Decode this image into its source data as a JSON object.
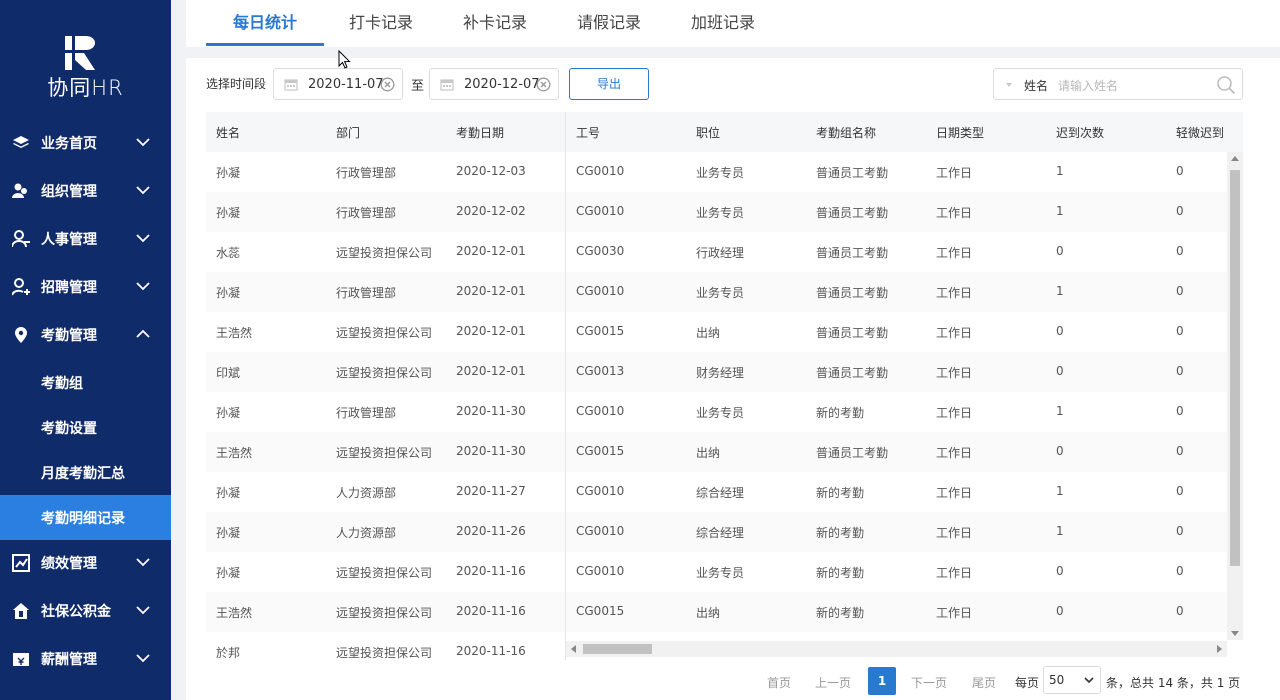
{
  "app": {
    "name": "协同HR"
  },
  "sidebar": {
    "menus": [
      {
        "label": "业务首页",
        "icon": "layers-icon",
        "expanded": false
      },
      {
        "label": "组织管理",
        "icon": "org-icon",
        "expanded": false
      },
      {
        "label": "人事管理",
        "icon": "person-icon",
        "expanded": false
      },
      {
        "label": "招聘管理",
        "icon": "person-add-icon",
        "expanded": false
      },
      {
        "label": "考勤管理",
        "icon": "location-pin-icon",
        "expanded": true
      },
      {
        "label": "绩效管理",
        "icon": "chart-icon",
        "expanded": false
      },
      {
        "label": "社保公积金",
        "icon": "house-icon",
        "expanded": false
      },
      {
        "label": "薪酬管理",
        "icon": "money-icon",
        "expanded": false
      }
    ],
    "submenu": [
      {
        "label": "考勤组",
        "active": false
      },
      {
        "label": "考勤设置",
        "active": false
      },
      {
        "label": "月度考勤汇总",
        "active": false
      },
      {
        "label": "考勤明细记录",
        "active": true
      }
    ]
  },
  "tabs": [
    {
      "label": "每日统计",
      "active": true
    },
    {
      "label": "打卡记录",
      "active": false
    },
    {
      "label": "补卡记录",
      "active": false
    },
    {
      "label": "请假记录",
      "active": false
    },
    {
      "label": "加班记录",
      "active": false
    }
  ],
  "filter": {
    "period_label": "选择时间段",
    "start_date": "2020-11-07",
    "to_label": "至",
    "end_date": "2020-12-07",
    "export_label": "导出",
    "search_field": "姓名",
    "search_placeholder": "请输入姓名"
  },
  "table": {
    "columns": [
      "姓名",
      "部门",
      "考勤日期",
      "工号",
      "职位",
      "考勤组名称",
      "日期类型",
      "迟到次数",
      "轻微迟到"
    ],
    "rows": [
      [
        "孙凝",
        "行政管理部",
        "2020-12-03",
        "CG0010",
        "业务专员",
        "普通员工考勤",
        "工作日",
        "1",
        "0"
      ],
      [
        "孙凝",
        "行政管理部",
        "2020-12-02",
        "CG0010",
        "业务专员",
        "普通员工考勤",
        "工作日",
        "1",
        "0"
      ],
      [
        "水蕊",
        "远望投资担保公司",
        "2020-12-01",
        "CG0030",
        "行政经理",
        "普通员工考勤",
        "工作日",
        "0",
        "0"
      ],
      [
        "孙凝",
        "行政管理部",
        "2020-12-01",
        "CG0010",
        "业务专员",
        "普通员工考勤",
        "工作日",
        "1",
        "0"
      ],
      [
        "王浩然",
        "远望投资担保公司",
        "2020-12-01",
        "CG0015",
        "出纳",
        "普通员工考勤",
        "工作日",
        "0",
        "0"
      ],
      [
        "印斌",
        "远望投资担保公司",
        "2020-12-01",
        "CG0013",
        "财务经理",
        "普通员工考勤",
        "工作日",
        "0",
        "0"
      ],
      [
        "孙凝",
        "行政管理部",
        "2020-11-30",
        "CG0010",
        "业务专员",
        "新的考勤",
        "工作日",
        "1",
        "0"
      ],
      [
        "王浩然",
        "远望投资担保公司",
        "2020-11-30",
        "CG0015",
        "出纳",
        "普通员工考勤",
        "工作日",
        "0",
        "0"
      ],
      [
        "孙凝",
        "人力资源部",
        "2020-11-27",
        "CG0010",
        "综合经理",
        "新的考勤",
        "工作日",
        "1",
        "0"
      ],
      [
        "孙凝",
        "人力资源部",
        "2020-11-26",
        "CG0010",
        "综合经理",
        "新的考勤",
        "工作日",
        "1",
        "0"
      ],
      [
        "孙凝",
        "远望投资担保公司",
        "2020-11-16",
        "CG0010",
        "业务专员",
        "新的考勤",
        "工作日",
        "0",
        "0"
      ],
      [
        "王浩然",
        "远望投资担保公司",
        "2020-11-16",
        "CG0015",
        "出纳",
        "新的考勤",
        "工作日",
        "0",
        "0"
      ],
      [
        "於邦",
        "远望投资担保公司",
        "2020-11-16",
        "",
        "",
        "",
        "",
        "",
        ""
      ]
    ]
  },
  "pagination": {
    "first": "首页",
    "prev": "上一页",
    "current": "1",
    "next": "下一页",
    "last": "尾页",
    "per_page_label": "每页",
    "page_size": "50",
    "summary": "条，总共 14 条，共 1 页"
  },
  "colors": {
    "sidebar": "#102b6a",
    "accent": "#2879d0",
    "active_sub": "#2a7fe0"
  }
}
